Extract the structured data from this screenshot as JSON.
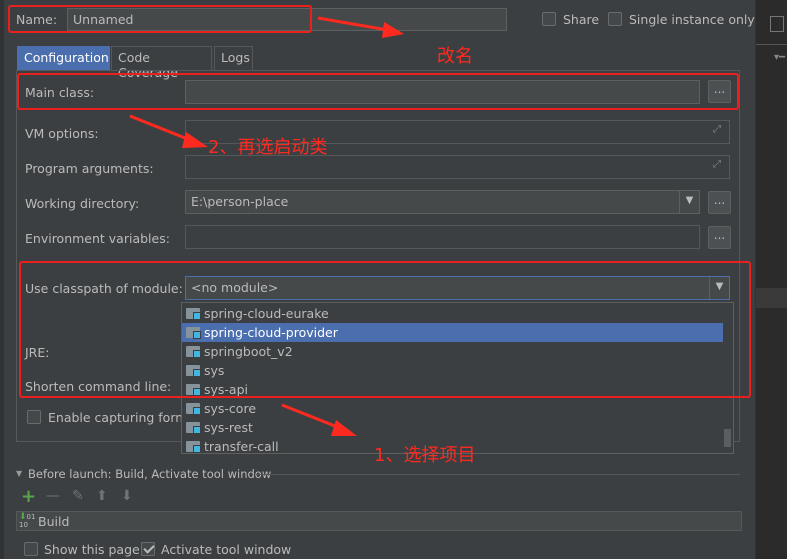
{
  "name_row": {
    "label": "Name:",
    "value": "Unnamed",
    "share_label": "Share",
    "single_instance_label": "Single instance only"
  },
  "tabs": [
    {
      "label": "Configuration"
    },
    {
      "label": "Code Coverage"
    },
    {
      "label": "Logs"
    }
  ],
  "form": {
    "main_class_label": "Main class:",
    "main_class_value": "",
    "vm_options_label": "VM options:",
    "program_args_label": "Program arguments:",
    "working_dir_label": "Working directory:",
    "working_dir_value": "E:\\person-place",
    "env_vars_label": "Environment variables:",
    "classpath_label": "Use classpath of module:",
    "classpath_value": "<no module>",
    "jre_label": "JRE:",
    "shorten_label": "Shorten command line:",
    "capture_label": "Enable capturing form",
    "browse_label": "..."
  },
  "dropdown": {
    "items": [
      "spring-cloud-eurake",
      "spring-cloud-provider",
      "springboot_v2",
      "sys",
      "sys-api",
      "sys-core",
      "sys-rest",
      "transfer-call"
    ],
    "selected_index": 1
  },
  "before_launch": {
    "header": "Before launch: Build, Activate tool window",
    "task": "Build"
  },
  "bottom": {
    "show_page_label": "Show this page",
    "activate_label": "Activate tool window",
    "activate_checked": true
  },
  "annotations": {
    "rename": "改名",
    "step2": "2、再选启动类",
    "step1": "1、选择项目"
  },
  "colors": {
    "annotation_red": "#e8211f",
    "selection_blue": "#4b6eaf",
    "background": "#3c3f41"
  }
}
